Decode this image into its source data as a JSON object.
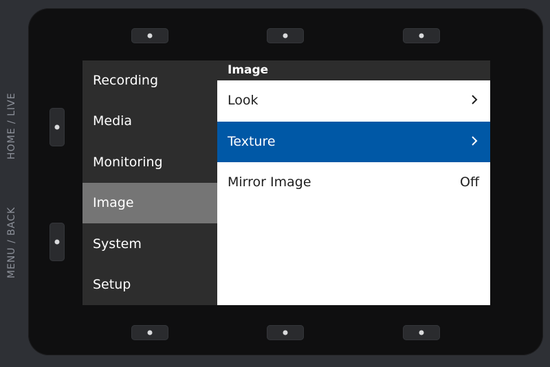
{
  "device": {
    "side_labels": {
      "home_live": "HOME / LIVE",
      "menu_back": "MENU / BACK"
    }
  },
  "menu": {
    "items": [
      {
        "label": "Recording",
        "active": false
      },
      {
        "label": "Media",
        "active": false
      },
      {
        "label": "Monitoring",
        "active": false
      },
      {
        "label": "Image",
        "active": true
      },
      {
        "label": "System",
        "active": false
      },
      {
        "label": "Setup",
        "active": false
      }
    ]
  },
  "content": {
    "title": "Image",
    "rows": [
      {
        "label": "Look",
        "value": "",
        "icon": "chevron-right-icon",
        "selected": false
      },
      {
        "label": "Texture",
        "value": "",
        "icon": "chevron-right-icon",
        "selected": true
      },
      {
        "label": "Mirror Image",
        "value": "Off",
        "icon": "",
        "selected": false
      }
    ]
  },
  "colors": {
    "selection": "#0058a6",
    "active_menu": "#757575",
    "panel_dark": "#2d2d2d"
  }
}
